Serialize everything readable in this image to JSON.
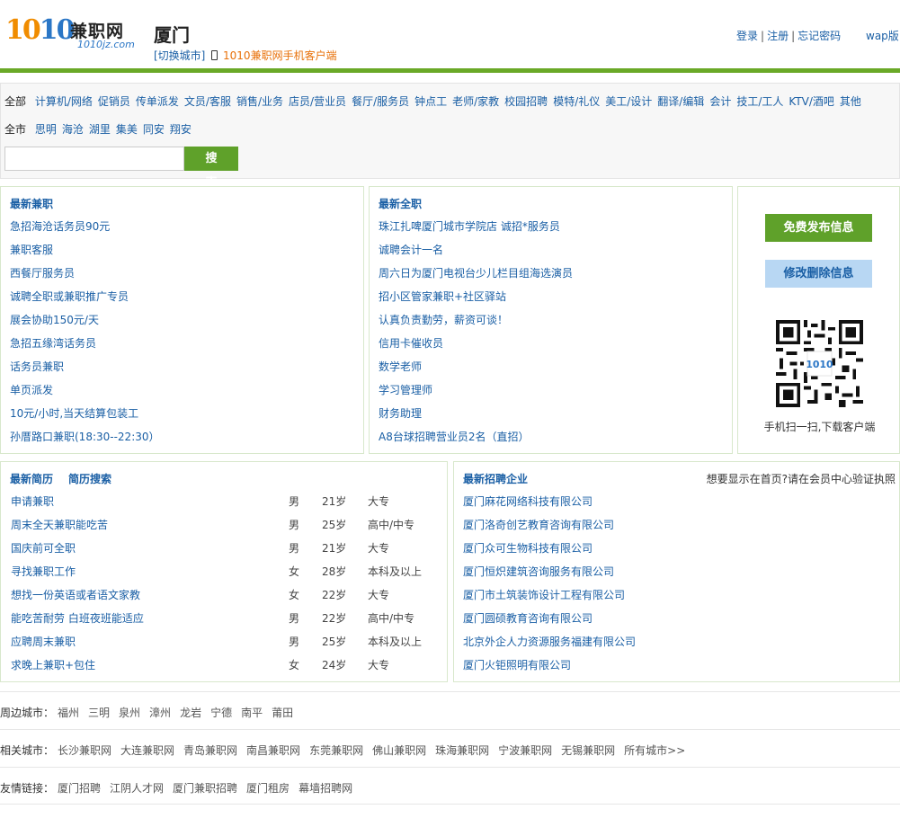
{
  "header": {
    "logo_number": "1010",
    "logo_brand": "兼职网",
    "logo_domain": "1010jz.com",
    "city": "厦门",
    "switch_city": "[切换城市]",
    "app_link": "1010兼职网手机客户端",
    "login": "登录",
    "register": "注册",
    "forgot": "忘记密码",
    "wap": "wap版"
  },
  "filter": {
    "category_all": "全部",
    "categories": [
      "计算机/网络",
      "促销员",
      "传单派发",
      "文员/客服",
      "销售/业务",
      "店员/营业员",
      "餐厅/服务员",
      "钟点工",
      "老师/家教",
      "校园招聘",
      "模特/礼仪",
      "美工/设计",
      "翻译/编辑",
      "会计",
      "技工/工人",
      "KTV/酒吧",
      "其他"
    ],
    "area_all": "全市",
    "areas": [
      "思明",
      "海沧",
      "湖里",
      "集美",
      "同安",
      "翔安"
    ],
    "search_value": "",
    "search_button": "搜 索"
  },
  "latest_part_time": {
    "title": "最新兼职",
    "items": [
      "急招海沧话务员90元",
      "兼职客服",
      "西餐厅服务员",
      "诚聘全职或兼职推广专员",
      "展会协助150元/天",
      "急招五缘湾话务员",
      "话务员兼职",
      "单页派发",
      "10元/小时,当天结算包装工",
      "孙厝路口兼职(18:30--22:30）"
    ]
  },
  "latest_full_time": {
    "title": "最新全职",
    "items": [
      "珠江扎啤厦门城市学院店 诚招*服务员",
      "诚聘会计一名",
      "周六日为厦门电视台少儿栏目组海选演员",
      "招小区管家兼职+社区驿站",
      "认真负责勤劳，薪资可谈！",
      "信用卡催收员",
      "数学老师",
      "学习管理师",
      "财务助理",
      "A8台球招聘营业员2名（直招）"
    ]
  },
  "sidebar": {
    "post_button": "免费发布信息",
    "edit_button": "修改删除信息",
    "qr_badge": "1010",
    "qr_caption": "手机扫一扫,下载客户端"
  },
  "resumes": {
    "title": "最新简历",
    "search_link": "简历搜索",
    "rows": [
      {
        "title": "申请兼职",
        "gender": "男",
        "age": "21岁",
        "edu": "大专"
      },
      {
        "title": "周末全天兼职能吃苦",
        "gender": "男",
        "age": "25岁",
        "edu": "高中/中专"
      },
      {
        "title": "国庆前可全职",
        "gender": "男",
        "age": "21岁",
        "edu": "大专"
      },
      {
        "title": "寻找兼职工作",
        "gender": "女",
        "age": "28岁",
        "edu": "本科及以上"
      },
      {
        "title": "想找一份英语或者语文家教",
        "gender": "女",
        "age": "22岁",
        "edu": "大专"
      },
      {
        "title": "能吃苦耐劳 白班夜班能适应",
        "gender": "男",
        "age": "22岁",
        "edu": "高中/中专"
      },
      {
        "title": "应聘周末兼职",
        "gender": "男",
        "age": "25岁",
        "edu": "本科及以上"
      },
      {
        "title": "求晚上兼职+包住",
        "gender": "女",
        "age": "24岁",
        "edu": "大专"
      }
    ]
  },
  "companies": {
    "title": "最新招聘企业",
    "note": "想要显示在首页?请在会员中心验证执照",
    "items": [
      "厦门麻花网络科技有限公司",
      "厦门洛奇创艺教育咨询有限公司",
      "厦门众可生物科技有限公司",
      "厦门恒炽建筑咨询服务有限公司",
      "厦门市土筑装饰设计工程有限公司",
      "厦门圆硕教育咨询有限公司",
      "北京外企人力资源服务福建有限公司",
      "厦门火钜照明有限公司"
    ]
  },
  "nearby": {
    "label": "周边城市：",
    "items": [
      "福州",
      "三明",
      "泉州",
      "漳州",
      "龙岩",
      "宁德",
      "南平",
      "莆田"
    ]
  },
  "related": {
    "label": "相关城市：",
    "items": [
      "长沙兼职网",
      "大连兼职网",
      "青岛兼职网",
      "南昌兼职网",
      "东莞兼职网",
      "佛山兼职网",
      "珠海兼职网",
      "宁波兼职网",
      "无锡兼职网",
      "所有城市>>"
    ]
  },
  "friends": {
    "label": "友情链接：",
    "items": [
      "厦门招聘",
      "江阴人才网",
      "厦门兼职招聘",
      "厦门租房",
      "幕墙招聘网"
    ]
  },
  "colors": {
    "brand_green": "#5fa12a",
    "link_blue": "#1a5fa5",
    "accent_orange": "#e8710a",
    "edit_blue": "#b8d7f3"
  }
}
